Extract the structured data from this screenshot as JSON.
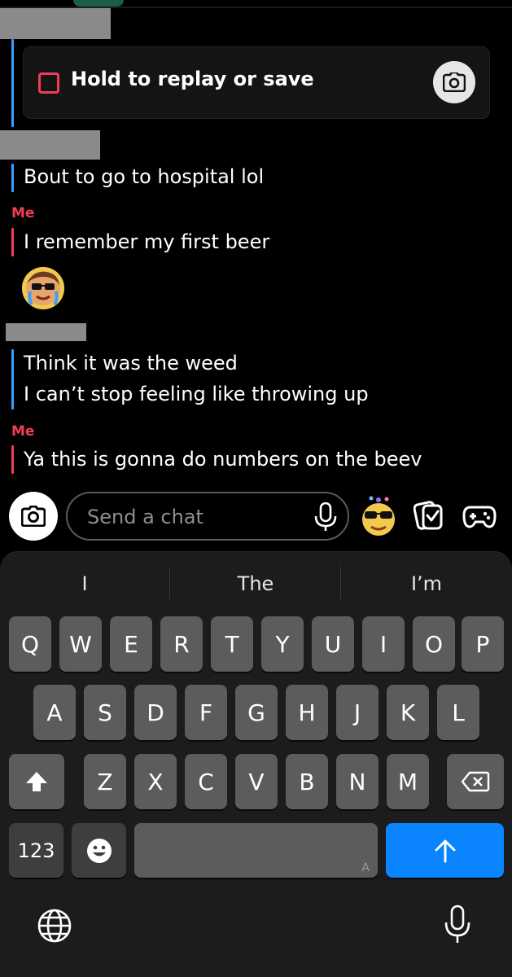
{
  "snap": {
    "label": "Hold to replay or save"
  },
  "messages": [
    {
      "text": "Bout to go to hospital lol"
    },
    {
      "sender": "Me",
      "text": "I remember my first beer"
    },
    {
      "text": "Think it was the weed"
    },
    {
      "text": "I can’t stop feeling like throwing up"
    },
    {
      "sender": "Me",
      "text": "Ya this is gonna do numbers on the beev"
    }
  ],
  "composer": {
    "placeholder": "Send a chat"
  },
  "keyboard": {
    "suggestions": [
      "I",
      "The",
      "I’m"
    ],
    "row1": [
      "Q",
      "W",
      "E",
      "R",
      "T",
      "Y",
      "U",
      "I",
      "O",
      "P"
    ],
    "row2": [
      "A",
      "S",
      "D",
      "F",
      "G",
      "H",
      "J",
      "K",
      "L"
    ],
    "row3": [
      "Z",
      "X",
      "C",
      "V",
      "B",
      "N",
      "M"
    ],
    "numbers_label": "123",
    "space_hint": "A"
  },
  "colors": {
    "accent_red": "#f23c57",
    "accent_blue": "#3aa0ff",
    "send_blue": "#0a84ff"
  }
}
